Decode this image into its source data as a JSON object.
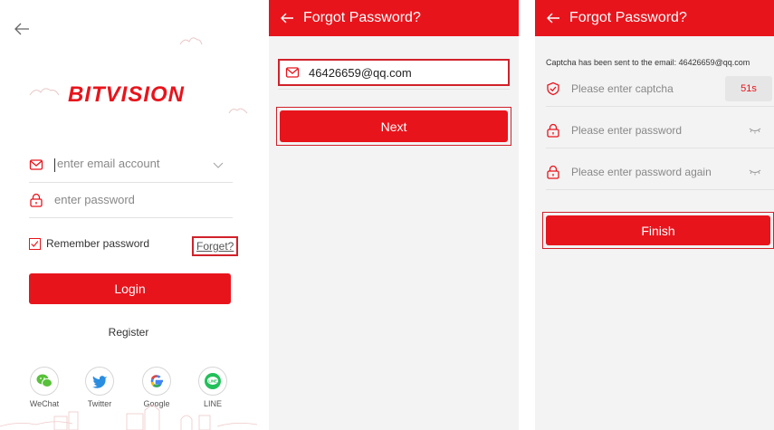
{
  "login": {
    "logo_text": "BITVISION",
    "email_placeholder": "enter email account",
    "password_placeholder": "enter password",
    "remember_label": "Remember password",
    "forget_label": "Forget?",
    "login_label": "Login",
    "register_label": "Register",
    "social": [
      {
        "name": "WeChat",
        "icon": "wechat-icon",
        "color": "#58c03a"
      },
      {
        "name": "Twitter",
        "icon": "twitter-icon",
        "color": "#2a8de0"
      },
      {
        "name": "Google",
        "icon": "google-icon",
        "color": "#4285f4"
      },
      {
        "name": "LINE",
        "icon": "line-icon",
        "color": "#22c05a"
      }
    ]
  },
  "forgot": {
    "title": "Forgot Password?",
    "email_value": "46426659@qq.com",
    "next_label": "Next"
  },
  "reset": {
    "title": "Forgot Password?",
    "sent_note": "Captcha has been sent to the email: 46426659@qq.com",
    "captcha_placeholder": "Please enter captcha",
    "countdown": "51s",
    "password_placeholder": "Please enter password",
    "password_again_placeholder": "Please enter password again",
    "finish_label": "Finish"
  },
  "colors": {
    "accent": "#e8141c",
    "highlight_border": "#d0222a"
  }
}
